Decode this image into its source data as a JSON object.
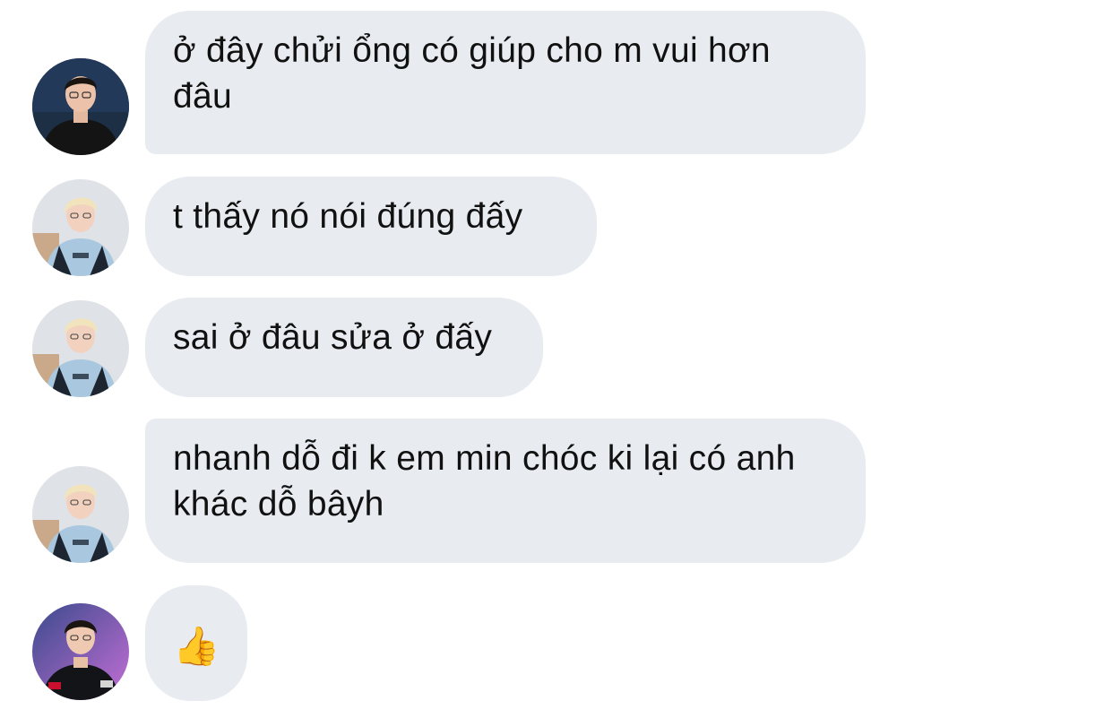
{
  "messages": [
    {
      "text": "ở đây chửi ổng có giúp cho m vui hơn đâu",
      "sender_avatar": "avatar-dark-hoodie"
    },
    {
      "text": "t thấy nó nói đúng đấy",
      "sender_avatar": "avatar-blonde-jacket"
    },
    {
      "text": "sai ở đâu sửa ở đấy",
      "sender_avatar": "avatar-blonde-jacket"
    },
    {
      "text": "nhanh dỗ đi k em min chóc ki lại có anh khác dỗ bâyh",
      "sender_avatar": "avatar-blonde-jacket"
    },
    {
      "text": "👍",
      "sender_avatar": "avatar-team-jersey"
    }
  ],
  "colors": {
    "bubble_background": "#e8ecf1",
    "text": "#111111",
    "page_background": "#ffffff"
  }
}
